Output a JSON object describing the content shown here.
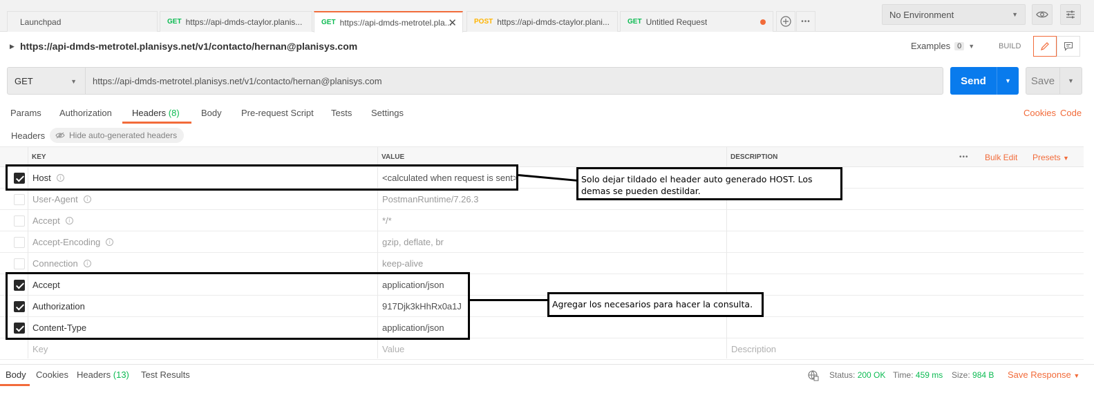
{
  "tabs": [
    {
      "method": "",
      "label": "Launchpad"
    },
    {
      "method": "GET",
      "label": "https://api-dmds-ctaylor.planis..."
    },
    {
      "method": "GET",
      "label": "https://api-dmds-metrotel.pla..."
    },
    {
      "method": "POST",
      "label": "https://api-dmds-ctaylor.plani..."
    },
    {
      "method": "GET",
      "label": "Untitled Request"
    }
  ],
  "tab_close": "✕",
  "environment": {
    "selected": "No Environment"
  },
  "request": {
    "title": "https://api-dmds-metrotel.planisys.net/v1/contacto/hernan@planisys.com",
    "examples_label": "Examples",
    "examples_count": "0",
    "build_label": "BUILD",
    "method": "GET",
    "url": "https://api-dmds-metrotel.planisys.net/v1/contacto/hernan@planisys.com",
    "send_label": "Send",
    "save_label": "Save"
  },
  "req_tabs": {
    "params": "Params",
    "authorization": "Authorization",
    "headers": "Headers",
    "headers_count": "(8)",
    "body": "Body",
    "prerequest": "Pre-request Script",
    "tests": "Tests",
    "settings": "Settings",
    "cookies": "Cookies",
    "code": "Code"
  },
  "headers_section": {
    "label": "Headers",
    "hide_auto": "Hide auto-generated headers",
    "col_key": "KEY",
    "col_value": "VALUE",
    "col_description": "DESCRIPTION",
    "more": "•••",
    "bulk_edit": "Bulk Edit",
    "presets": "Presets",
    "rows": [
      {
        "checked": true,
        "key": "Host",
        "value": "<calculated when request is sent>",
        "auto": false,
        "info": true
      },
      {
        "checked": false,
        "key": "User-Agent",
        "value": "PostmanRuntime/7.26.3",
        "auto": true,
        "info": true
      },
      {
        "checked": false,
        "key": "Accept",
        "value": "*/*",
        "auto": true,
        "info": true
      },
      {
        "checked": false,
        "key": "Accept-Encoding",
        "value": "gzip, deflate, br",
        "auto": true,
        "info": true
      },
      {
        "checked": false,
        "key": "Connection",
        "value": "keep-alive",
        "auto": true,
        "info": true
      },
      {
        "checked": true,
        "key": "Accept",
        "value": "application/json",
        "auto": false,
        "info": false
      },
      {
        "checked": true,
        "key": "Authorization",
        "value": "917Djk3kHhRx0a1J",
        "auto": false,
        "info": false
      },
      {
        "checked": true,
        "key": "Content-Type",
        "value": "application/json",
        "auto": false,
        "info": false
      }
    ],
    "placeholder": {
      "key": "Key",
      "value": "Value",
      "description": "Description"
    }
  },
  "annotations": {
    "note1": "Solo dejar tildado el header auto generado HOST. Los demas se pueden destildar.",
    "note2": "Agregar los necesarios para hacer la consulta."
  },
  "response": {
    "body": "Body",
    "cookies": "Cookies",
    "headers": "Headers",
    "headers_count": "(13)",
    "test_results": "Test Results",
    "status_label": "Status:",
    "status_value": "200 OK",
    "time_label": "Time:",
    "time_value": "459 ms",
    "size_label": "Size:",
    "size_value": "984 B",
    "save_response": "Save Response"
  },
  "colors": {
    "accent": "#f26b3a",
    "send": "#097bed",
    "get": "#0cbb52",
    "post": "#ffb400"
  }
}
